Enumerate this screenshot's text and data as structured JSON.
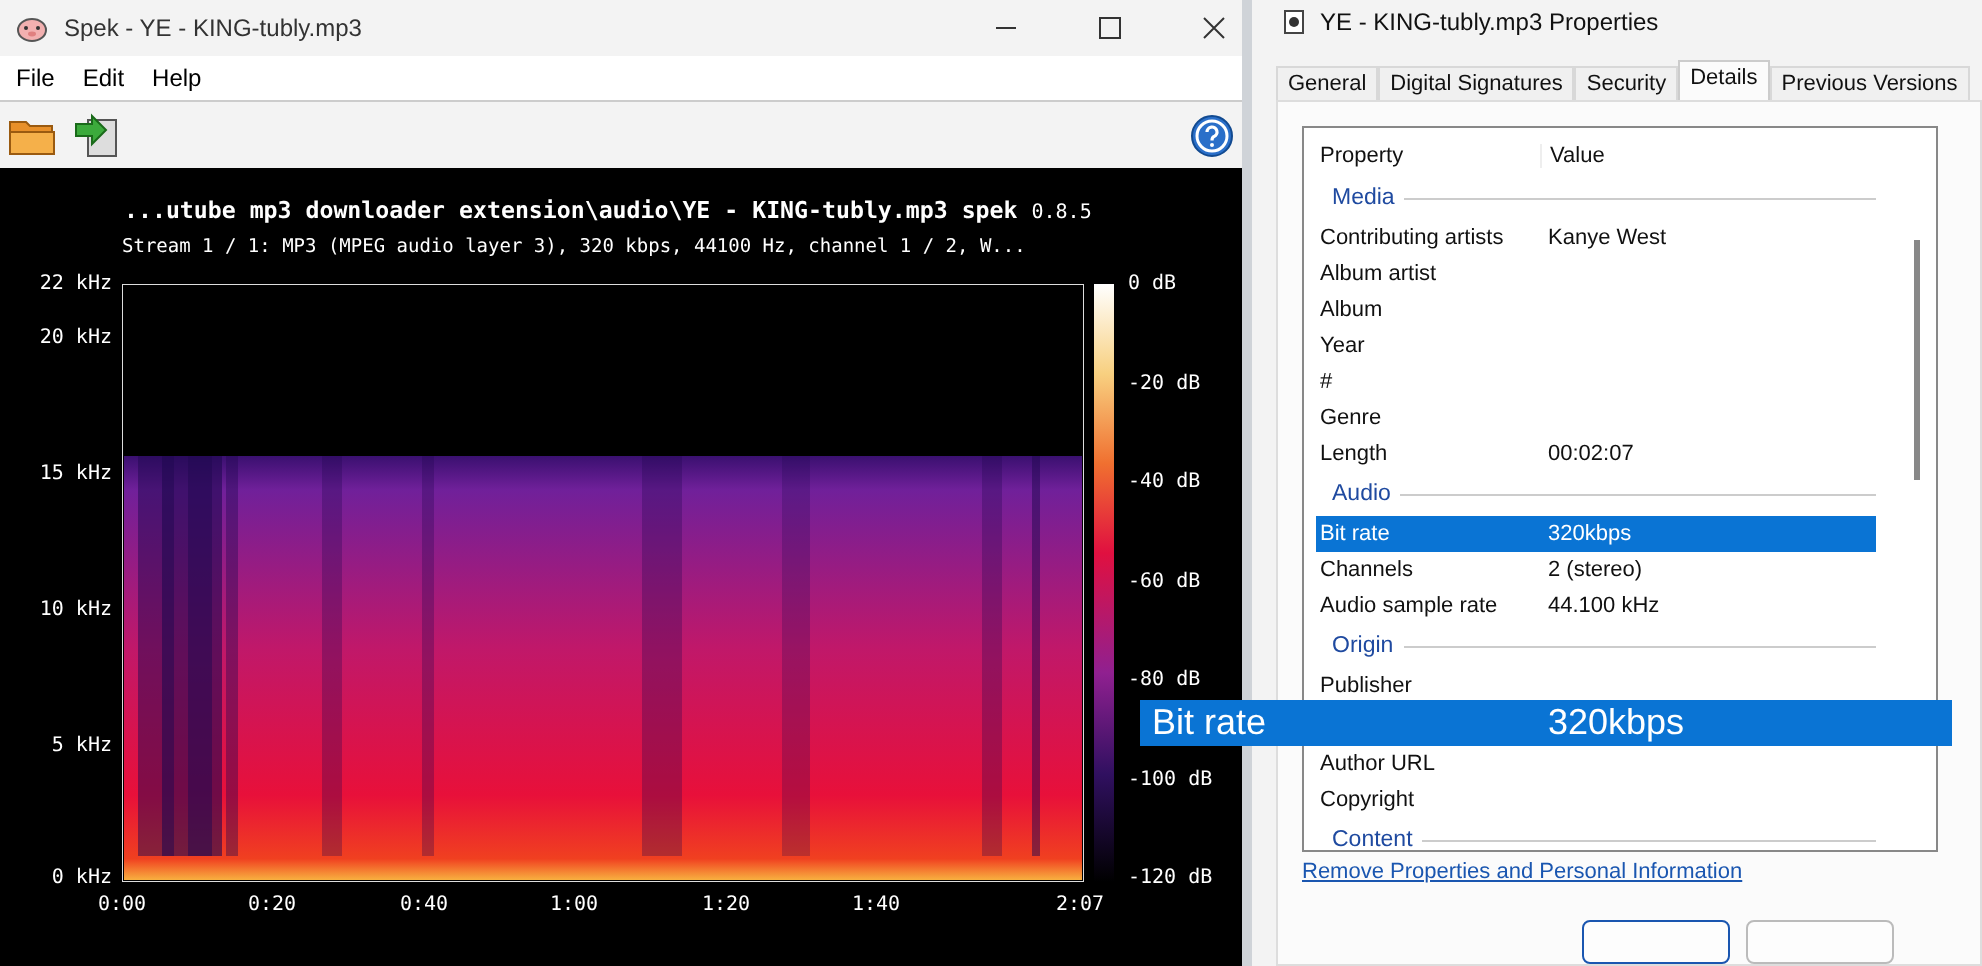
{
  "spek_window": {
    "title": "Spek - YE - KING-tubly.mp3",
    "menu": [
      "File",
      "Edit",
      "Help"
    ],
    "header": {
      "path": "...utube mp3 downloader extension\\audio\\YE - KING-tubly.mp3",
      "app": "spek",
      "version": "0.8.5",
      "stream": "Stream 1 / 1: MP3 (MPEG audio layer 3), 320 kbps, 44100 Hz, channel 1 / 2, W..."
    },
    "y_ticks": [
      "22 kHz",
      "20 kHz",
      "15 kHz",
      "10 kHz",
      "5 kHz",
      "0 kHz"
    ],
    "x_ticks": [
      "0:00",
      "0:20",
      "0:40",
      "1:00",
      "1:20",
      "1:40",
      "2:07"
    ],
    "db_ticks": [
      "0 dB",
      "-20 dB",
      "-40 dB",
      "-60 dB",
      "-80 dB",
      "-100 dB",
      "-120 dB"
    ]
  },
  "properties_window": {
    "title": "YE - KING-tubly.mp3 Properties",
    "tabs": [
      {
        "label": "General",
        "selected": false
      },
      {
        "label": "Digital Signatures",
        "selected": false
      },
      {
        "label": "Security",
        "selected": false
      },
      {
        "label": "Details",
        "selected": true
      },
      {
        "label": "Previous Versions",
        "selected": false
      }
    ],
    "columns": [
      "Property",
      "Value"
    ],
    "rows": [
      {
        "kind": "group",
        "name": "Media"
      },
      {
        "kind": "row",
        "name": "Contributing artists",
        "value": "Kanye West",
        "selected": false
      },
      {
        "kind": "row",
        "name": "Album artist",
        "selected": false
      },
      {
        "kind": "row",
        "name": "Album",
        "selected": false
      },
      {
        "kind": "row",
        "name": "Year",
        "selected": false
      },
      {
        "kind": "row",
        "name": "#",
        "selected": false
      },
      {
        "kind": "row",
        "name": "Genre",
        "selected": false
      },
      {
        "kind": "row",
        "name": "Length",
        "value": "00:02:07",
        "selected": false
      },
      {
        "kind": "group",
        "name": "Audio"
      },
      {
        "kind": "row",
        "name": "Bit rate",
        "value": "320kbps",
        "selected": true
      },
      {
        "kind": "row",
        "name": "Channels",
        "value": "2 (stereo)",
        "selected": false
      },
      {
        "kind": "row",
        "name": "Audio sample rate",
        "value": "44.100 kHz",
        "selected": false
      },
      {
        "kind": "group",
        "name": "Origin"
      },
      {
        "kind": "row",
        "name": "Publisher",
        "selected": false
      },
      {
        "kind": "covered"
      },
      {
        "kind": "row",
        "name": "Author URL",
        "selected": false
      },
      {
        "kind": "row",
        "name": "Copyright",
        "selected": false
      },
      {
        "kind": "group",
        "name": "Content"
      }
    ],
    "link": "Remove Properties and Personal Information"
  },
  "drag_overlay": {
    "name": "Bit rate",
    "value": "320kbps"
  }
}
